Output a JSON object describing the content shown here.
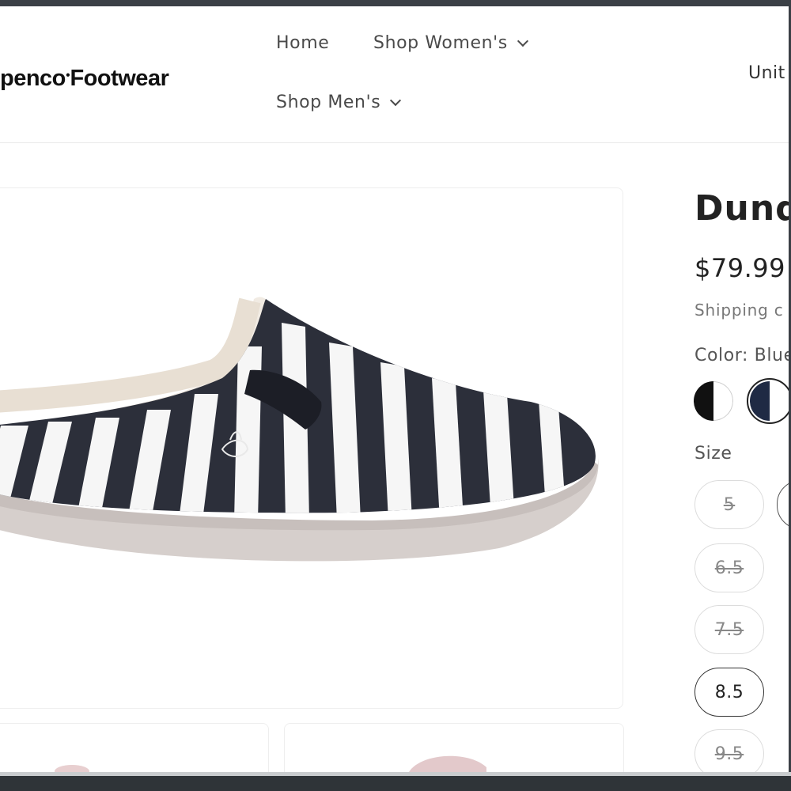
{
  "header": {
    "logo": "penco",
    "logo_word": "Footwear",
    "nav": {
      "home": "Home",
      "women": "Shop Women's",
      "men": "Shop Men's"
    },
    "country": "Unit"
  },
  "product": {
    "title": "Dund",
    "price": "$79.99",
    "shipping": "Shipping c",
    "color_label": "Color: Blue",
    "swatches": [
      {
        "name": "Black/White",
        "colors": [
          "#111111",
          "#ffffff"
        ],
        "selected": false
      },
      {
        "name": "Blue/White",
        "colors": [
          "#1f2a44",
          "#ffffff"
        ],
        "selected": true
      }
    ],
    "size_label": "Size",
    "sizes": [
      {
        "label": "5",
        "available": false
      },
      {
        "label": "6.5",
        "available": false
      },
      {
        "label": "7.5",
        "available": false
      },
      {
        "label": "8.5",
        "available": true
      },
      {
        "label": "9.5",
        "available": false
      }
    ]
  }
}
